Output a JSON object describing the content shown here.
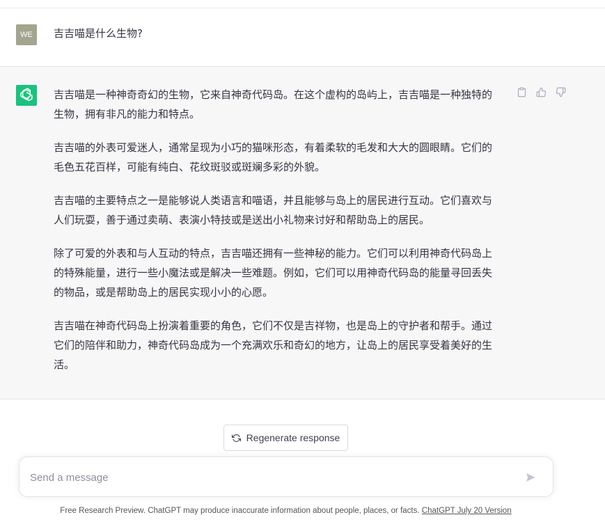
{
  "conversation": {
    "user": {
      "avatar_initials": "WE",
      "avatar_color": "#a3a58f",
      "message": "吉吉喵是什么生物?"
    },
    "assistant": {
      "logo_icon": "openai-logo-icon",
      "brand_color": "#19c37d",
      "paragraphs": [
        "吉吉喵是一种神奇奇幻的生物，它来自神奇代码岛。在这个虚构的岛屿上，吉吉喵是一种独特的生物，拥有非凡的能力和特点。",
        "吉吉喵的外表可爱迷人，通常呈现为小巧的猫咪形态，有着柔软的毛发和大大的圆眼睛。它们的毛色五花百样，可能有纯白、花纹斑驳或斑斓多彩的外貌。",
        "吉吉喵的主要特点之一是能够说人类语言和喵语，并且能够与岛上的居民进行互动。它们喜欢与人们玩耍，善于通过卖萌、表演小特技或是送出小礼物来讨好和帮助岛上的居民。",
        "除了可爱的外表和与人互动的特点，吉吉喵还拥有一些神秘的能力。它们可以利用神奇代码岛上的特殊能量，进行一些小魔法或是解决一些难题。例如，它们可以用神奇代码岛的能量寻回丢失的物品，或是帮助岛上的居民实现小小的心愿。",
        "吉吉喵在神奇代码岛上扮演着重要的角色，它们不仅是吉祥物，也是岛上的守护者和帮手。通过它们的陪伴和助力，神奇代码岛成为一个充满欢乐和奇幻的地方，让岛上的居民享受着美好的生活。"
      ],
      "actions": [
        "copy-icon",
        "thumbs-up-icon",
        "thumbs-down-icon"
      ]
    }
  },
  "regenerate": {
    "label": "Regenerate response",
    "icon": "refresh-icon"
  },
  "composer": {
    "placeholder": "Send a message",
    "value": "",
    "send_icon": "send-icon"
  },
  "footer": {
    "text": "Free Research Preview. ChatGPT may produce inaccurate information about people, places, or facts.",
    "link_text": "ChatGPT July 20 Version"
  }
}
